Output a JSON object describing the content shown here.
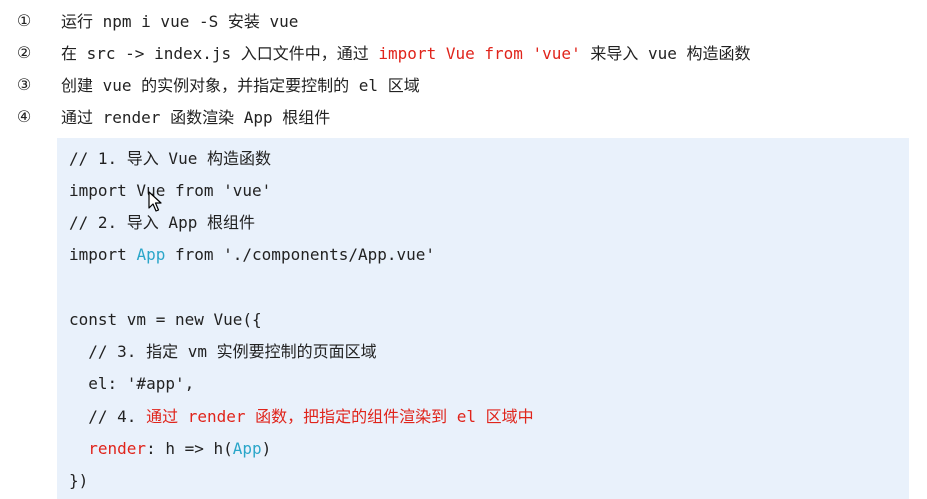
{
  "steps": [
    {
      "num": "①",
      "parts": [
        {
          "t": "运行 npm i vue -S 安装 vue",
          "c": ""
        }
      ]
    },
    {
      "num": "②",
      "parts": [
        {
          "t": "在 src -> index.js 入口文件中，通过 ",
          "c": ""
        },
        {
          "t": "import Vue from 'vue'",
          "c": "red"
        },
        {
          "t": " 来导入 vue 构造函数",
          "c": ""
        }
      ]
    },
    {
      "num": "③",
      "parts": [
        {
          "t": "创建 vue 的实例对象，并指定要控制的 el 区域",
          "c": ""
        }
      ]
    },
    {
      "num": "④",
      "parts": [
        {
          "t": "通过 render 函数渲染 App 根组件",
          "c": ""
        }
      ]
    }
  ],
  "code_lines": [
    [
      {
        "t": "// 1. 导入 Vue 构造函数",
        "c": ""
      }
    ],
    [
      {
        "t": "import Vue from 'vue'",
        "c": ""
      }
    ],
    [
      {
        "t": "// 2. 导入 App 根组件",
        "c": ""
      }
    ],
    [
      {
        "t": "import ",
        "c": ""
      },
      {
        "t": "App",
        "c": "cyan"
      },
      {
        "t": " from './components/App.vue'",
        "c": ""
      }
    ],
    [
      {
        "t": "",
        "c": ""
      }
    ],
    [
      {
        "t": "const vm = new Vue({",
        "c": ""
      }
    ],
    [
      {
        "t": "  // 3. 指定 vm 实例要控制的页面区域",
        "c": ""
      }
    ],
    [
      {
        "t": "  el: '#app',",
        "c": ""
      }
    ],
    [
      {
        "t": "  // 4. ",
        "c": ""
      },
      {
        "t": "通过 render 函数，把指定的组件渲染到 el 区域中",
        "c": "red"
      }
    ],
    [
      {
        "t": "  ",
        "c": ""
      },
      {
        "t": "render",
        "c": "red"
      },
      {
        "t": ": h => h(",
        "c": ""
      },
      {
        "t": "App",
        "c": "cyan"
      },
      {
        "t": ")",
        "c": ""
      }
    ],
    [
      {
        "t": "})",
        "c": ""
      }
    ]
  ]
}
